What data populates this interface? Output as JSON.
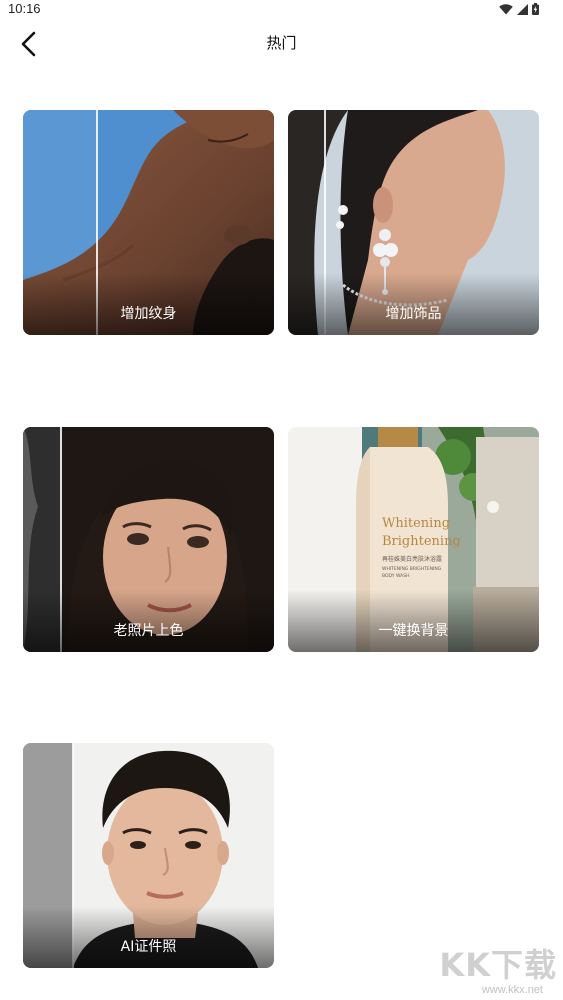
{
  "status_bar": {
    "time": "10:16",
    "icons": [
      "wifi-icon",
      "signal-icon",
      "battery-icon"
    ]
  },
  "header": {
    "title": "热门",
    "back_icon": "chevron-left-icon"
  },
  "cards": [
    {
      "label": "增加纹身"
    },
    {
      "label": "增加饰品"
    },
    {
      "label": "老照片上色"
    },
    {
      "label": "一键换背景"
    },
    {
      "label": "AI证件照"
    }
  ],
  "product_bottle": {
    "line1": "Whitening",
    "line2": "Brightening",
    "cn": "再桂姝美白亮肤沐浴露",
    "sub1": "WHITENING BRIGHTENING",
    "sub2": "BODY WASH"
  },
  "watermark": {
    "logo": "KK下载",
    "url": "www.kkx.net"
  },
  "colors": {
    "background": "#ffffff",
    "label_text": "#ffffff",
    "title_text": "#111111"
  }
}
